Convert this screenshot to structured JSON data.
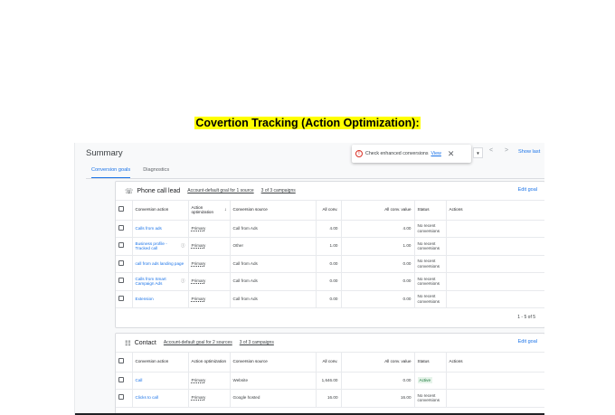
{
  "slide_title": "Covertion Tracking (Action Optimization):",
  "page": {
    "title": "Summary"
  },
  "tabs": [
    {
      "label": "Conversion goals",
      "active": true
    },
    {
      "label": "Diagnostics",
      "active": false
    }
  ],
  "toast": {
    "message": "Check enhanced conversions",
    "link": "View"
  },
  "toolbar": {
    "show_last": "Show last"
  },
  "columns": {
    "action": "Conversion action",
    "optimization": "Action optimization",
    "source": "Conversion source",
    "all_conv": "All conv.",
    "all_conv_value": "All conv. value",
    "status": "Status",
    "actions": "Actions"
  },
  "goal1": {
    "title": "Phone call lead",
    "default": "Account-default goal for 1 source",
    "campaigns": "3 of 3 campaigns",
    "edit": "Edit goal",
    "rows": [
      {
        "action": "Calls from ads",
        "info": false,
        "optimization": "Primary",
        "source": "Call from Ads",
        "all_conv": "4.00",
        "value": "4.00",
        "status": "No recent conversions"
      },
      {
        "action": "Business profile - Tracked call",
        "info": true,
        "optimization": "Primary",
        "source": "Other",
        "all_conv": "1.00",
        "value": "1.00",
        "status": "No recent conversions"
      },
      {
        "action": "call from ads landing page",
        "info": false,
        "optimization": "Primary",
        "source": "Call from Ads",
        "all_conv": "0.00",
        "value": "0.00",
        "status": "No recent conversions"
      },
      {
        "action": "Calls from Smart Campaign Ads",
        "info": true,
        "optimization": "Primary",
        "source": "Call from Ads",
        "all_conv": "0.00",
        "value": "0.00",
        "status": "No recent conversions"
      },
      {
        "action": "Extension",
        "info": false,
        "optimization": "Primary",
        "source": "Call from Ads",
        "all_conv": "0.00",
        "value": "0.00",
        "status": "No recent conversions"
      }
    ],
    "pagination": "1 - 5 of 5"
  },
  "goal2": {
    "title": "Contact",
    "default": "Account-default goal for 2 sources",
    "campaigns": "3 of 3 campaigns",
    "edit": "Edit goal",
    "rows": [
      {
        "action": "Call",
        "optimization": "Primary",
        "source": "Website",
        "all_conv": "1,646.00",
        "value": "0.00",
        "status": "Active"
      },
      {
        "action": "Clicks to call",
        "optimization": "Primary",
        "source": "Google hosted",
        "all_conv": "16.00",
        "value": "16.00",
        "status": "No recent conversions"
      }
    ]
  },
  "icons": {
    "phone": "phone-icon",
    "contact": "contact-icon",
    "warning": "warning-icon",
    "close": "close-icon",
    "info": "info-icon",
    "sort": "sort-down-icon"
  }
}
